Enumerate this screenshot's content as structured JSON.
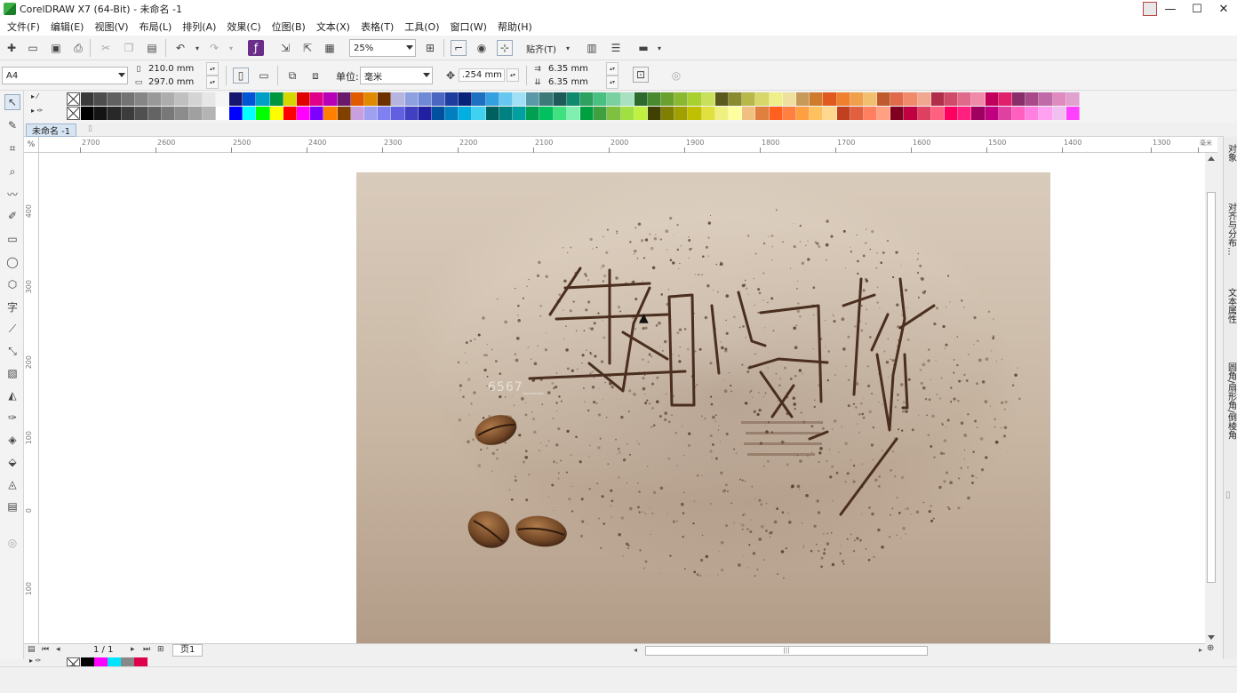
{
  "window": {
    "title": "CorelDRAW X7 (64-Bit) - 未命名 -1",
    "controls": [
      "—",
      "☐",
      "✕"
    ]
  },
  "menu": [
    "文件(F)",
    "编辑(E)",
    "视图(V)",
    "布局(L)",
    "排列(A)",
    "效果(C)",
    "位图(B)",
    "文本(X)",
    "表格(T)",
    "工具(O)",
    "窗口(W)",
    "帮助(H)"
  ],
  "toolbar": {
    "zoom_value": "25%",
    "snap_label": "贴齐(T)"
  },
  "property_bar": {
    "page_size": "A4",
    "width": "210.0 mm",
    "height": "297.0 mm",
    "unit_label": "单位:",
    "unit_value": "毫米",
    "nudge": ".254 mm",
    "dup_x": "6.35 mm",
    "dup_y": "6.35 mm"
  },
  "document": {
    "tab_label": "未命名 -1"
  },
  "ruler": {
    "h_ticks": [
      "2700",
      "2600",
      "2500",
      "2400",
      "2300",
      "2200",
      "2100",
      "2000",
      "1900",
      "1800",
      "1700",
      "1600",
      "1500",
      "1400",
      "1300"
    ],
    "h_unit": "毫米",
    "v_ticks": [
      "400",
      "300",
      "200",
      "100",
      "0",
      "100"
    ],
    "corner": "%"
  },
  "artwork": {
    "calligraphy": "生如夏花",
    "watermark": "6567___"
  },
  "dockers": [
    "对象",
    "对齐与分布...",
    "文本属性",
    "圆角/扇形角/倒棱角"
  ],
  "page_nav": {
    "page_count": "1 / 1",
    "page_tab": "页1"
  },
  "colors": {
    "palette_row1": [
      "#3a3a3a",
      "#4d4d4d",
      "#616161",
      "#737373",
      "#868686",
      "#999999",
      "#adadad",
      "#c0c0c0",
      "#d4d4d4",
      "#e6e6e6",
      "#f5f5f5",
      "#16166e",
      "#0055d4",
      "#00a0c6",
      "#00963e",
      "#d6d600",
      "#e00000",
      "#e0008a",
      "#b800b8",
      "#6a1a6a",
      "#e05a00",
      "#e08a00",
      "#6e3200",
      "#b5b5e0",
      "#8fa0e0",
      "#6f8ad4",
      "#4a66c0",
      "#1e3c9e",
      "#0a237a",
      "#1e70c0",
      "#33a0e0",
      "#66c8f0",
      "#a0dff5",
      "#5a9aa8",
      "#3c7a7a",
      "#1e5a5a",
      "#0f8a6e",
      "#2ea060",
      "#4ac080",
      "#7ad0a0",
      "#a8e0c0",
      "#2e6a2e",
      "#4a8a2e",
      "#6aa02e",
      "#8ab82e",
      "#a8d02e",
      "#c8e05a",
      "#5a5a1e",
      "#8a8a2e",
      "#b8b84a",
      "#d8d86a",
      "#f0f08a",
      "#f0e0a0",
      "#c89a5a",
      "#d07a2e",
      "#e05a1e",
      "#f0802e",
      "#f0a04a",
      "#f0c070",
      "#c05a2e",
      "#e06a4a",
      "#f08a6a",
      "#f0a890",
      "#b02e4a",
      "#d04a6a",
      "#e06a8a",
      "#f08aa8",
      "#c0005a",
      "#e0206a",
      "#8a2e6a",
      "#a84a8a",
      "#c06aa8",
      "#e08ac0",
      "#e0a0d0"
    ],
    "palette_row2": [
      "#000000",
      "#141414",
      "#282828",
      "#3c3c3c",
      "#505050",
      "#646464",
      "#787878",
      "#8c8c8c",
      "#a0a0a0",
      "#b4b4b4",
      "#ffffff",
      "#0000ff",
      "#00ffff",
      "#00ff00",
      "#ffff00",
      "#ff0000",
      "#ff00ff",
      "#8000ff",
      "#ff8000",
      "#804000",
      "#c8a0e0",
      "#a0a0f0",
      "#8080f0",
      "#6060e0",
      "#4040c0",
      "#2020a0",
      "#0050a0",
      "#0080c0",
      "#00b0e0",
      "#40d0f0",
      "#006060",
      "#008080",
      "#00a0a0",
      "#00a050",
      "#00c060",
      "#40e080",
      "#80f0b0",
      "#00a040",
      "#40a040",
      "#80c040",
      "#a0e040",
      "#c0f040",
      "#404000",
      "#808000",
      "#a0a000",
      "#c0c000",
      "#e0e040",
      "#f0f080",
      "#ffffa0",
      "#f0c080",
      "#e08040",
      "#ff6020",
      "#ff8040",
      "#ffa040",
      "#ffc060",
      "#ffd890",
      "#c04020",
      "#e06040",
      "#ff8060",
      "#ffa080",
      "#800020",
      "#c00040",
      "#e04060",
      "#ff6080",
      "#ff0060",
      "#ff2080",
      "#a00060",
      "#c00080",
      "#e040a0",
      "#ff60c0",
      "#ff80e0",
      "#ffa0f0",
      "#f0c0f0",
      "#ff40ff"
    ],
    "doc_palette": [
      "#000000",
      "#ff00ff",
      "#00e5ff",
      "#888888",
      "#e0004a"
    ],
    "art_ink": "#4a2e1e"
  }
}
